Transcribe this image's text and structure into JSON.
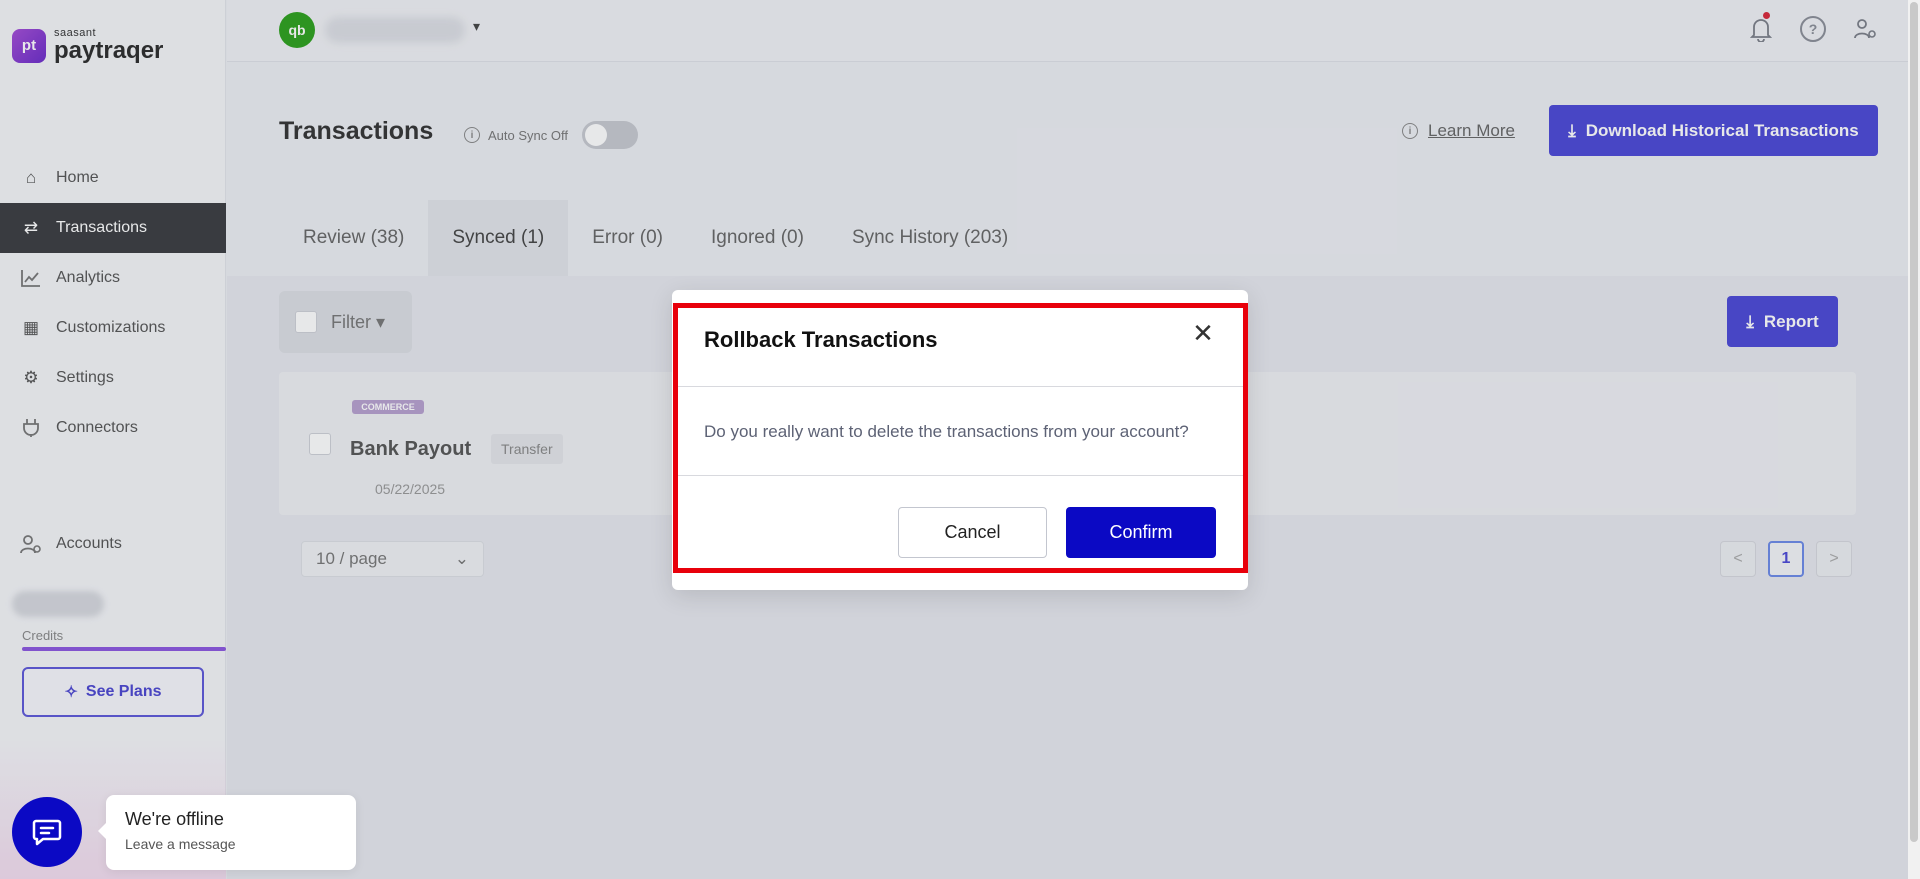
{
  "brand": {
    "small": "saasant",
    "name": "paytraqer",
    "mark": "pt"
  },
  "sidebar": {
    "items": [
      {
        "label": "Home",
        "icon": "home-icon",
        "glyph": "⌂"
      },
      {
        "label": "Transactions",
        "icon": "transfer-arrows-icon",
        "glyph": "⇄"
      },
      {
        "label": "Analytics",
        "icon": "line-chart-icon",
        "glyph": "📈"
      },
      {
        "label": "Customizations",
        "icon": "grid-icon",
        "glyph": "▦"
      },
      {
        "label": "Settings",
        "icon": "gear-icon",
        "glyph": "⚙"
      },
      {
        "label": "Connectors",
        "icon": "plug-icon",
        "glyph": "⏚"
      }
    ],
    "accounts_label": "Accounts",
    "credits_label": "Credits",
    "see_plans_label": "See Plans"
  },
  "topbar": {
    "qb_mark": "qb"
  },
  "header": {
    "title": "Transactions",
    "auto_sync_label": "Auto Sync Off",
    "auto_sync_on": false,
    "learn_more": "Learn More",
    "download_label": "Download Historical Transactions"
  },
  "tabs": [
    {
      "label": "Review (38)"
    },
    {
      "label": "Synced (1)",
      "active": true
    },
    {
      "label": "Error (0)"
    },
    {
      "label": "Ignored (0)"
    },
    {
      "label": "Sync History (203)"
    }
  ],
  "toolbar": {
    "filter_label": "Filter",
    "report_label": "Report"
  },
  "transaction": {
    "source_logo": "COMMERCE",
    "title": "Bank Payout",
    "badge": "Transfer",
    "date": "05/22/2025"
  },
  "pagination": {
    "page_size": "10 / page",
    "current_page": "1",
    "prev": "<",
    "next": ">"
  },
  "modal": {
    "title": "Rollback Transactions",
    "message": "Do you really want to delete the transactions from your account?",
    "cancel_label": "Cancel",
    "confirm_label": "Confirm",
    "highlight_color": "#e8000b"
  },
  "chat": {
    "title": "We're offline",
    "subtitle": "Leave a message"
  },
  "colors": {
    "primary": "#4b47d6",
    "confirm": "#0b09c4",
    "sidebar_active": "#3a3b3f"
  }
}
